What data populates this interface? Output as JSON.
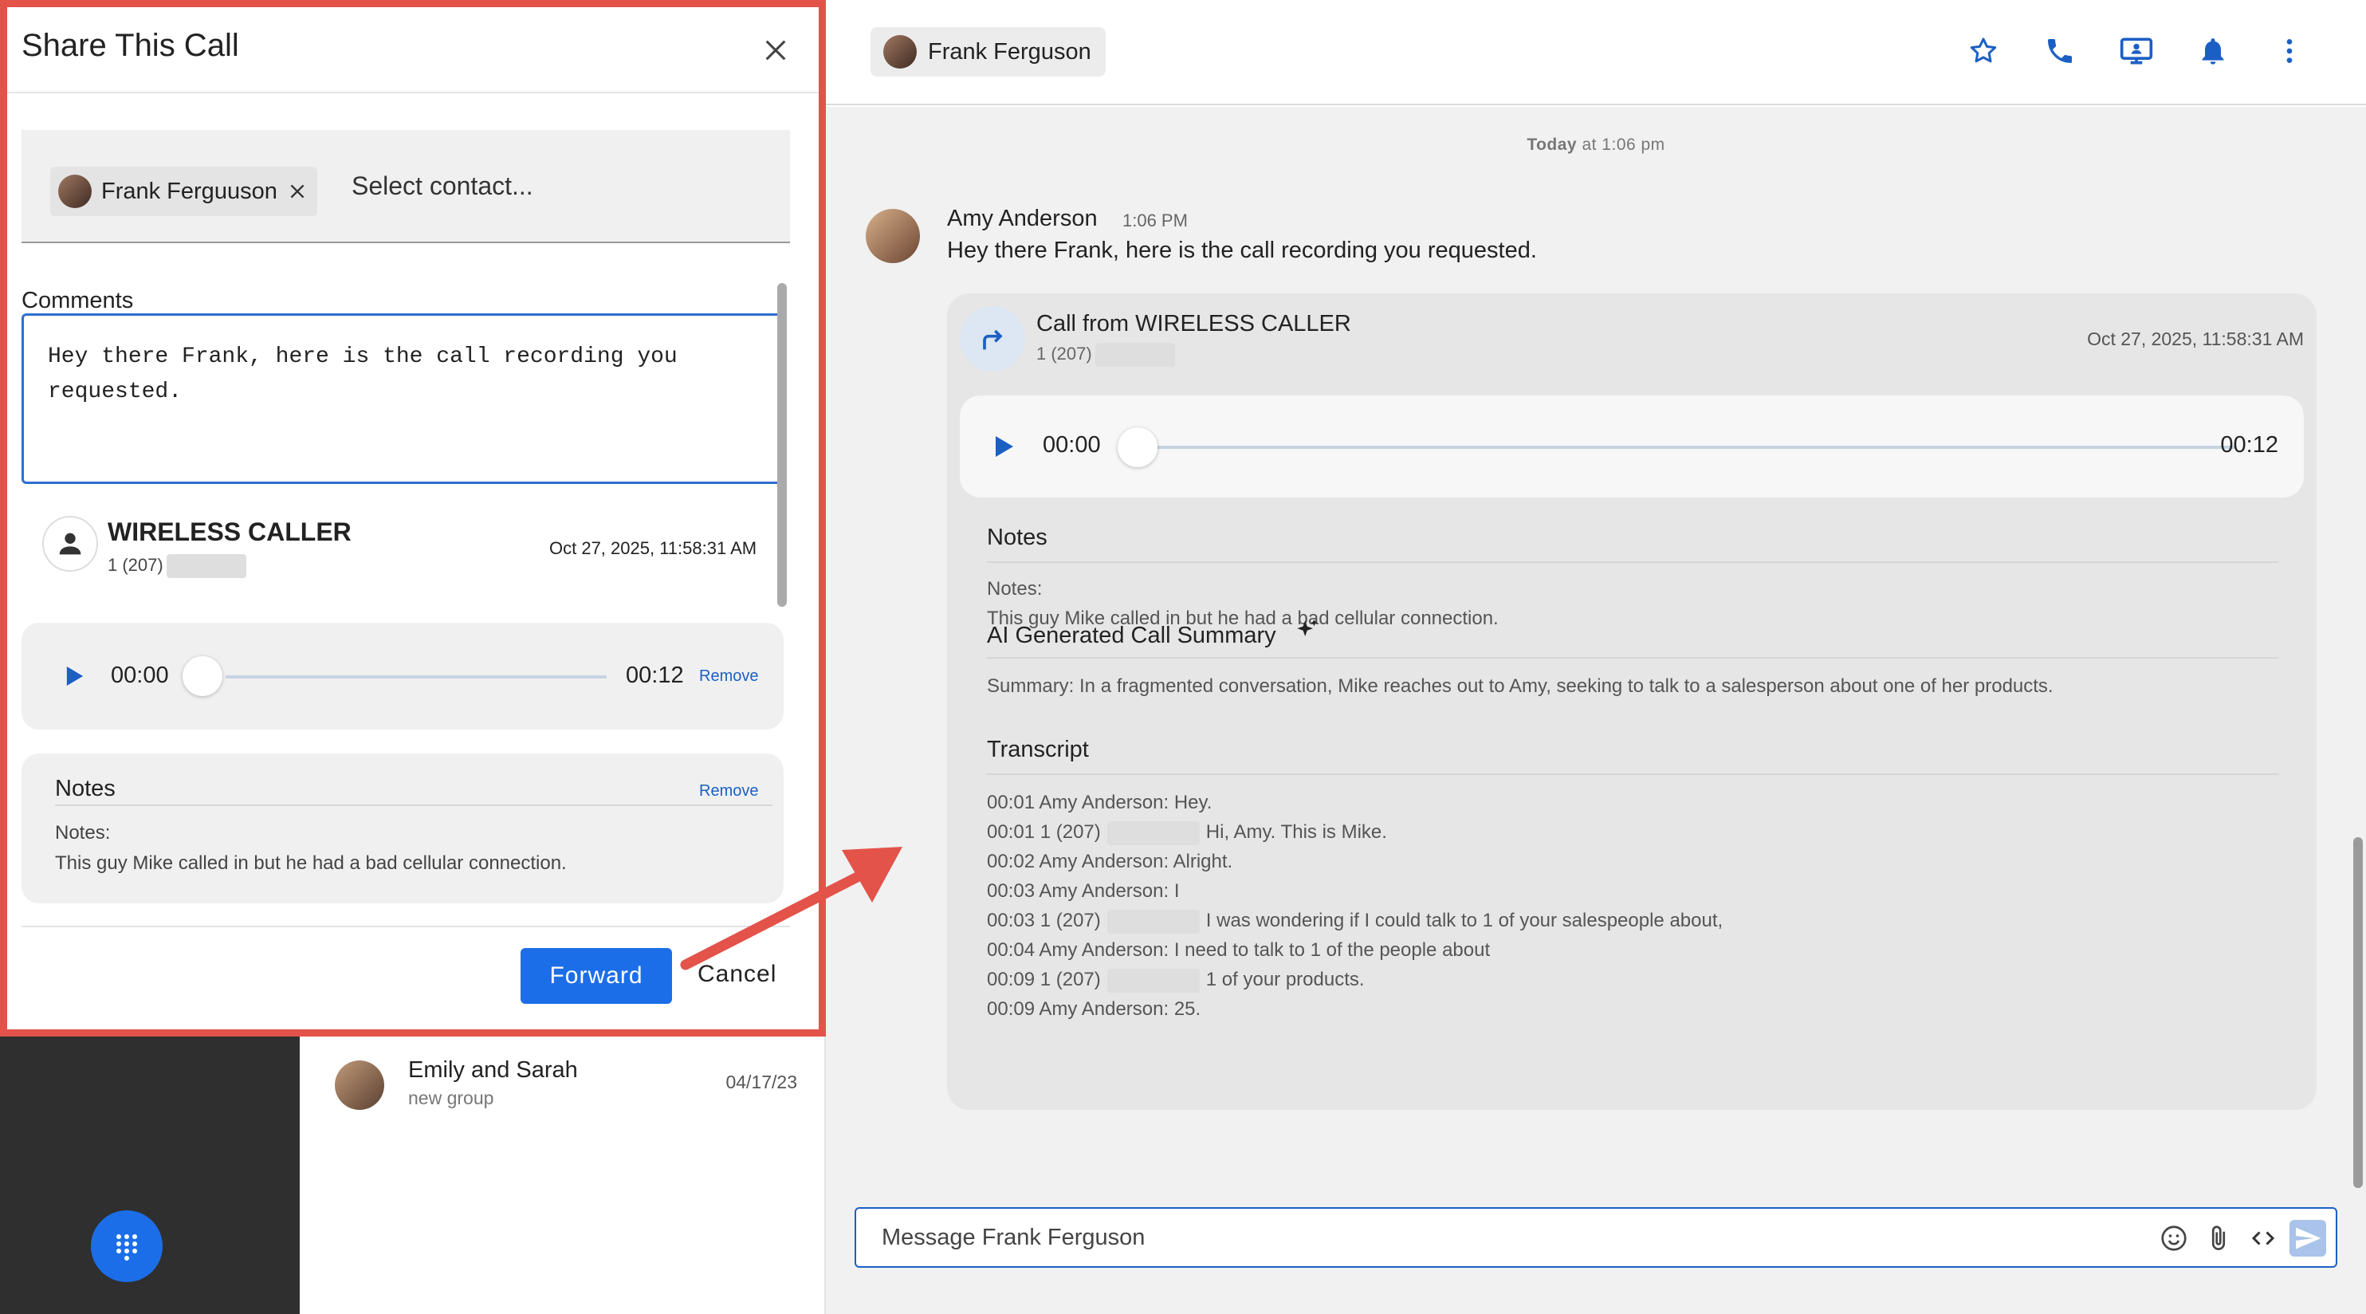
{
  "colors": {
    "accent": "#1c6ee8",
    "highlight_border": "#e3534a",
    "link": "#1c5fc4"
  },
  "modal": {
    "title": "Share This Call",
    "recipient_chip": "Frank Ferguuson",
    "select_placeholder": "Select contact...",
    "comments_label": "Comments",
    "comments_value": "Hey there Frank, here is the call recording you requested.",
    "attachment": {
      "caller": "WIRELESS CALLER",
      "number": "1 (207)",
      "date": "Oct 27, 2025, 11:58:31 AM",
      "time_current": "00:00",
      "time_total": "00:12",
      "remove_label": "Remove",
      "progress": 0
    },
    "notes": {
      "heading": "Notes",
      "remove_label": "Remove",
      "label": "Notes:",
      "text": "This guy Mike called in but he had a bad cellular connection."
    },
    "forward_label": "Forward",
    "cancel_label": "Cancel"
  },
  "conversation_list": {
    "item": {
      "name": "Emily and Sarah",
      "subtitle": "new group",
      "date": "04/17/23"
    }
  },
  "chat": {
    "header_contact": "Frank Ferguson",
    "header_icons": [
      "star-icon",
      "phone-icon",
      "screen-share-icon",
      "bell-icon",
      "more-vertical-icon"
    ],
    "day_separator_bold": "Today",
    "day_separator_rest": "at 1:06 pm",
    "message": {
      "author": "Amy Anderson",
      "time": "1:06 PM",
      "text": "Hey there Frank, here is the call recording you requested."
    },
    "call_card": {
      "title": "Call from WIRELESS CALLER",
      "number": "1 (207)",
      "date": "Oct 27, 2025, 11:58:31 AM",
      "time_current": "00:00",
      "time_total": "00:12",
      "progress": 0,
      "notes_heading": "Notes",
      "notes_label": "Notes:",
      "notes_text": "This guy Mike called in but he had a bad cellular connection.",
      "summary_heading": "AI Generated Call Summary",
      "summary_text": "Summary: In a fragmented conversation, Mike reaches out to Amy, seeking to talk to a salesperson about one of her products.",
      "transcript_heading": "Transcript",
      "transcript": [
        {
          "prefix": "00:01 Amy Anderson: Hey.",
          "redacted": false,
          "suffix": ""
        },
        {
          "prefix": "00:01 1 (207)",
          "redacted": true,
          "suffix": "Hi, Amy. This is Mike."
        },
        {
          "prefix": "00:02 Amy Anderson: Alright.",
          "redacted": false,
          "suffix": ""
        },
        {
          "prefix": "00:03 Amy Anderson: I",
          "redacted": false,
          "suffix": ""
        },
        {
          "prefix": "00:03 1 (207)",
          "redacted": true,
          "suffix": "I was wondering if I could talk to 1 of your salespeople about,"
        },
        {
          "prefix": "00:04 Amy Anderson: I need to talk to 1 of the people about",
          "redacted": false,
          "suffix": ""
        },
        {
          "prefix": "00:09 1 (207)",
          "redacted": true,
          "suffix": "1 of your products."
        },
        {
          "prefix": "00:09 Amy Anderson: 25.",
          "redacted": false,
          "suffix": ""
        }
      ]
    },
    "composer_placeholder": "Message Frank Ferguson",
    "composer_icons": [
      "emoji-icon",
      "paperclip-icon",
      "code-icon",
      "send-icon"
    ]
  }
}
